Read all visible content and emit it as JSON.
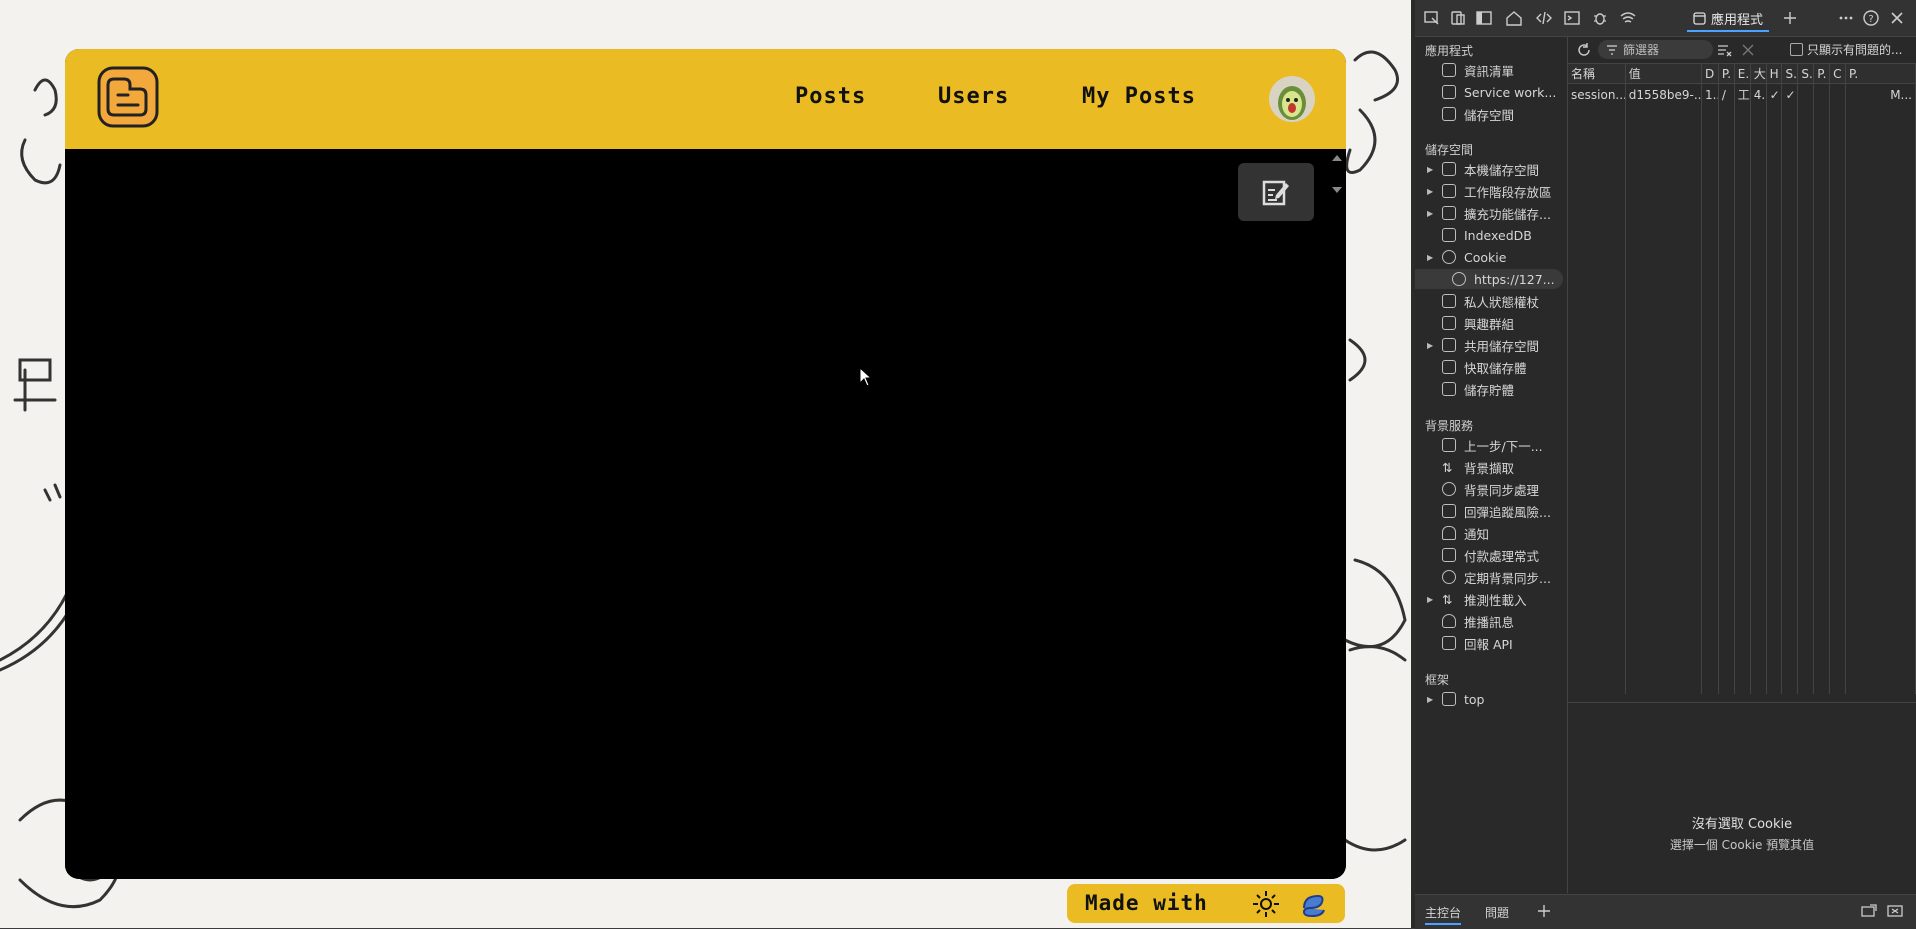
{
  "site": {
    "nav": {
      "posts": "Posts",
      "users": "Users",
      "my_posts": "My Posts"
    },
    "footer_badge": "Made with",
    "colors": {
      "header": "#ebbb24",
      "body": "#000000",
      "background": "#f3f2ee"
    },
    "icons": {
      "logo": "blogger-logo-icon",
      "avatar": "avocado-avatar",
      "edit": "edit-note-icon",
      "footer": [
        "sun-icon",
        "spiral-icon"
      ]
    }
  },
  "devtools": {
    "active_tab": "應用程式",
    "filter_placeholder": "篩選器",
    "only_issues_label": "只顯示有問題的...",
    "sections": {
      "application": "應用程式",
      "storage": "儲存空間",
      "background_services": "背景服務",
      "frames": "框架"
    },
    "application_items": [
      "資訊清單",
      "Service work...",
      "儲存空間"
    ],
    "storage_items": [
      "本機儲存空間",
      "工作階段存放區",
      "擴充功能儲存...",
      "IndexedDB",
      "Cookie",
      "https://127...",
      "私人狀態權杖",
      "興趣群組",
      "共用儲存空間",
      "快取儲存體",
      "儲存貯體"
    ],
    "background_items": [
      "上一步/下一...",
      "背景擷取",
      "背景同步處理",
      "回彈追蹤風險...",
      "通知",
      "付款處理常式",
      "定期背景同步...",
      "推測性載入",
      "推播訊息",
      "回報 API"
    ],
    "frame_items": [
      "top"
    ],
    "cookie_table": {
      "headers": [
        "名稱",
        "值",
        "D",
        "P.",
        "E.",
        "大",
        "H",
        "S.",
        "S.",
        "P.",
        "C",
        "P."
      ],
      "rows": [
        [
          "session...",
          "d1558be9-...",
          "1...",
          "/",
          "工",
          "4...",
          "✓",
          "✓",
          "",
          "",
          "",
          "M..."
        ]
      ]
    },
    "empty_title": "沒有選取 Cookie",
    "empty_subtitle": "選擇一個 Cookie 預覽其值",
    "drawer_tabs": [
      "主控台",
      "問題"
    ]
  }
}
